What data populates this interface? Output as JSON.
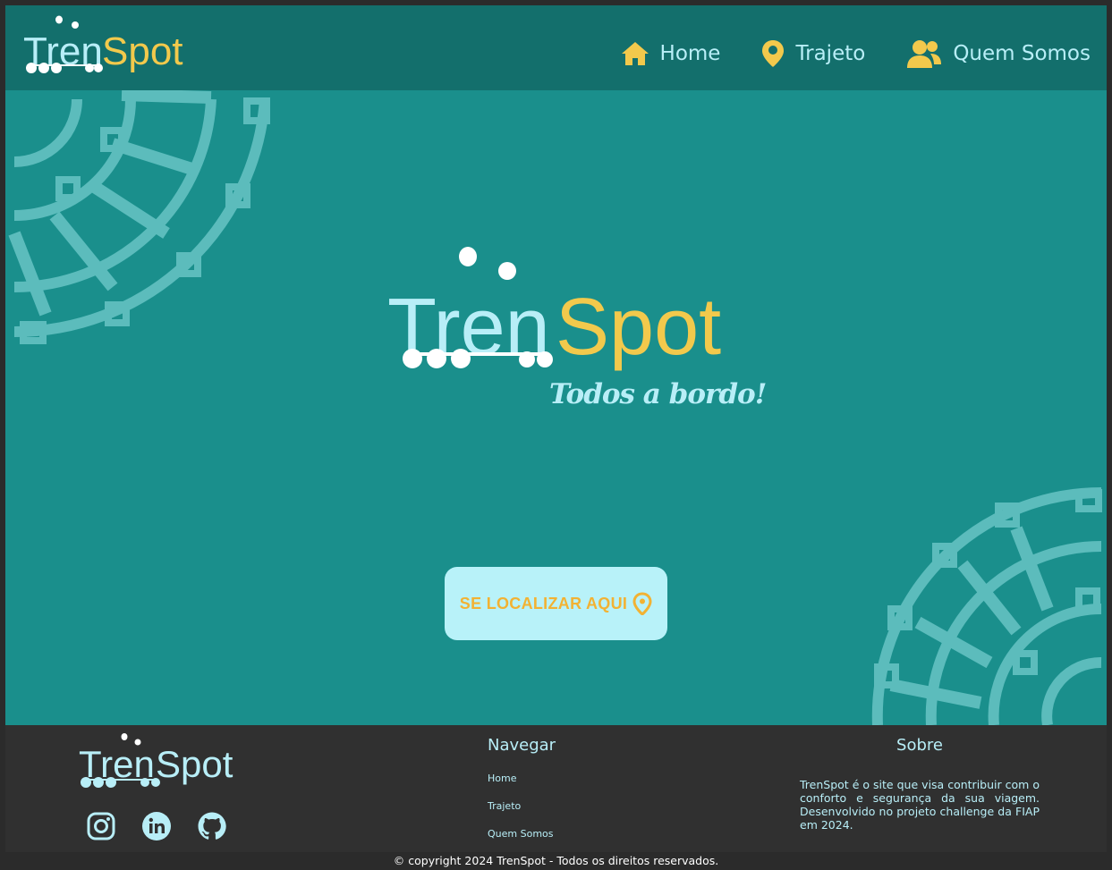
{
  "brand": {
    "name_part1": "Tren",
    "name_part2": "Spot",
    "tagline": "Todos a bordo!"
  },
  "colors": {
    "header_bg": "#136f6c",
    "hero_bg": "#1a8f8c",
    "footer_bg": "#303030",
    "accent_light": "#b8eef7",
    "accent_yellow": "#f2c94c",
    "cta_text": "#f2b233"
  },
  "nav": {
    "items": [
      {
        "label": "Home",
        "icon": "home-icon"
      },
      {
        "label": "Trajeto",
        "icon": "map-pin-icon"
      },
      {
        "label": "Quem Somos",
        "icon": "users-icon"
      }
    ]
  },
  "hero": {
    "cta_label": "SE LOCALIZAR AQUI",
    "cta_icon": "map-pin-icon"
  },
  "footer": {
    "nav_title": "Navegar",
    "nav_links": [
      "Home",
      "Trajeto",
      "Quem Somos"
    ],
    "about_title": "Sobre",
    "about_text": "TrenSpot é o site que visa contribuir com o conforto e segurança da sua viagem. Desenvolvido no projeto challenge da FIAP em 2024.",
    "socials": [
      "instagram-icon",
      "linkedin-icon",
      "github-icon"
    ],
    "copyright": "© copyright 2024 TrenSpot - Todos os direitos reservados."
  }
}
